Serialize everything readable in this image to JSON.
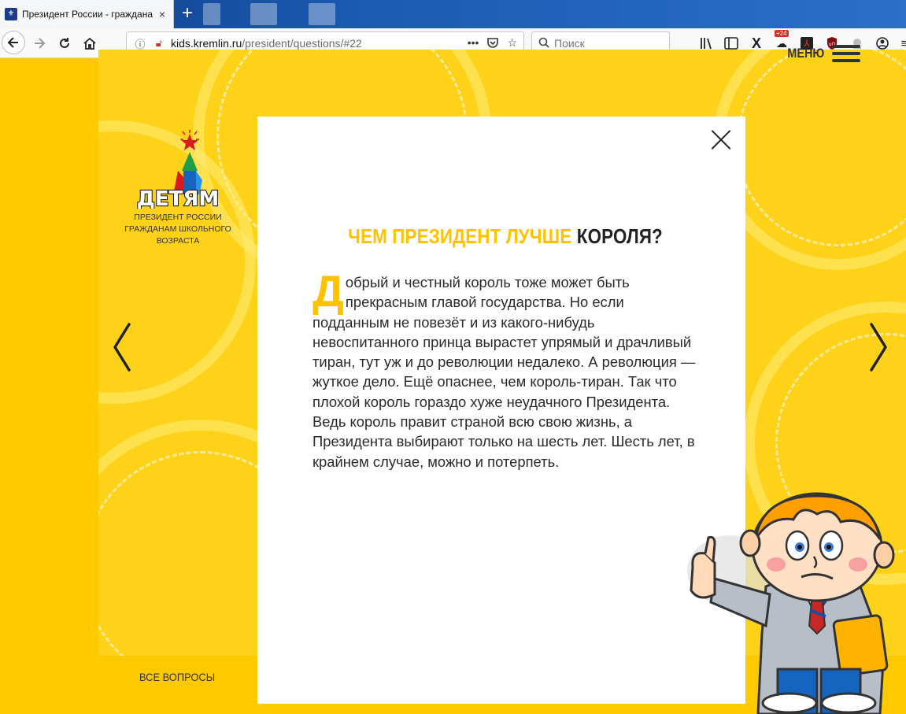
{
  "browser": {
    "tab_title": "Президент России - граждана",
    "tab_close": "×",
    "new_tab": "+",
    "url_domain": "kids.kremlin.ru",
    "url_path": "/president/questions/#22",
    "url_more": "•••",
    "search_placeholder": "Поиск",
    "badge_count": "+24"
  },
  "site": {
    "logo_caption_line1": "ПРЕЗИДЕНТ РОССИИ",
    "logo_caption_line2": "ГРАЖДАНАМ ШКОЛЬНОГО",
    "logo_caption_line3": "ВОЗРАСТА",
    "logo_word": "ДЕТЯМ",
    "menu_label": "МЕНЮ",
    "all_questions": "ВСЕ ВОПРОСЫ",
    "prev_arrow": "❮",
    "next_arrow": "❯"
  },
  "question": {
    "title_highlight": "ЧЕМ ПРЕЗИДЕНТ ЛУЧШЕ",
    "title_dark": "КОРОЛЯ?",
    "dropcap": "Д",
    "answer_rest": "обрый и честный король тоже может быть прекрасным главой государства. Но если подданным не повезёт и из какого-нибудь невоспитанного принца вырастет упрямый и драчливый тиран, тут уж и до революции недалеко. А революция — жуткое дело. Ещё опаснее, чем король-тиран. Так что плохой король гораздо хуже неудачного Президента. Ведь король правит страной всю свою жизнь, а Президента выбирают только на шесть лет. Шесть лет, в крайнем случае, можно и потерпеть."
  },
  "colors": {
    "page_bg": "#ffc900",
    "accent_yellow": "#ffc200",
    "text_dark": "#222222"
  }
}
